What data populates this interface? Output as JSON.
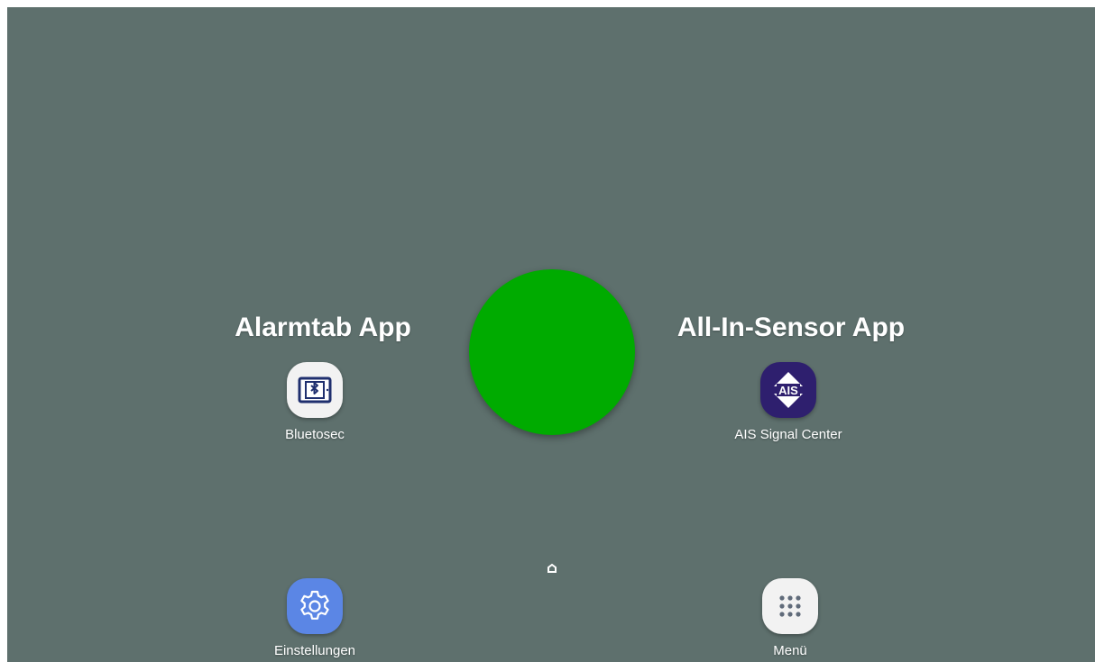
{
  "headings": {
    "left": "Alarmtab App",
    "right": "All-In-Sensor App"
  },
  "apps": {
    "bluetosec": {
      "label": "Bluetosec",
      "icon": "bluetosec-tablet-icon"
    },
    "ais": {
      "label": "AIS Signal Center",
      "icon": "ais-logo-icon",
      "icon_text": "AIS"
    },
    "settings": {
      "label": "Einstellungen",
      "icon": "gear-icon"
    },
    "menu": {
      "label": "Menü",
      "icon": "app-grid-icon"
    }
  },
  "status": {
    "color": "#00ab00"
  },
  "colors": {
    "background": "#5e706d",
    "settings_tile": "#5b86e5",
    "ais_tile": "#2e1f6e",
    "light_tile": "#f2f2f2"
  }
}
